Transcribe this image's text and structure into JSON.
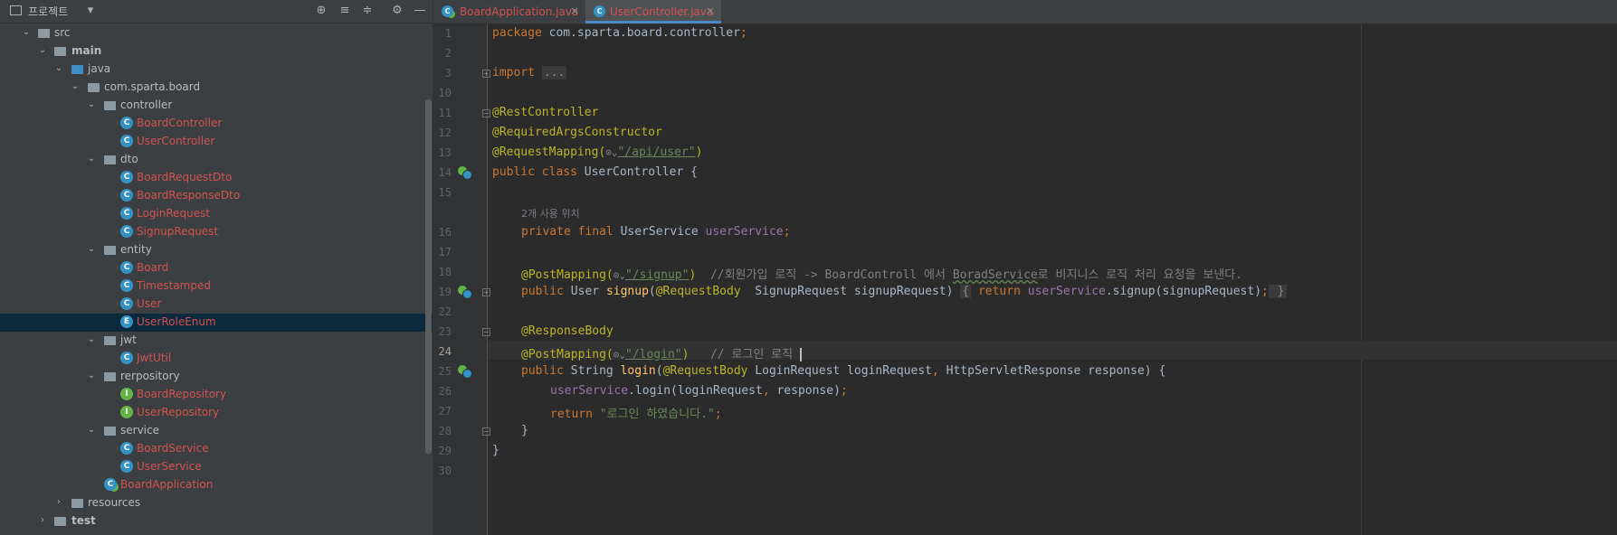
{
  "project_panel": {
    "title": "프로젝트",
    "dropdown_icon": "chevron-down-icon",
    "toolbar_icons": [
      "locate-icon",
      "expand-all-icon",
      "collapse-all-icon",
      "gear-icon",
      "minimize-icon"
    ]
  },
  "tree": {
    "items": [
      {
        "label": "src"
      },
      {
        "label": "main"
      },
      {
        "label": "java"
      },
      {
        "label": "com.sparta.board"
      },
      {
        "label": "controller"
      },
      {
        "label": "BoardController"
      },
      {
        "label": "UserController"
      },
      {
        "label": "dto"
      },
      {
        "label": "BoardRequestDto"
      },
      {
        "label": "BoardResponseDto"
      },
      {
        "label": "LoginRequest"
      },
      {
        "label": "SignupRequest"
      },
      {
        "label": "entity"
      },
      {
        "label": "Board"
      },
      {
        "label": "Timestamped"
      },
      {
        "label": "User"
      },
      {
        "label": "UserRoleEnum"
      },
      {
        "label": "jwt"
      },
      {
        "label": "JwtUtil"
      },
      {
        "label": "rerpository"
      },
      {
        "label": "BoardRepository"
      },
      {
        "label": "UserRepository"
      },
      {
        "label": "service"
      },
      {
        "label": "BoardService"
      },
      {
        "label": "UserService"
      },
      {
        "label": "BoardApplication"
      },
      {
        "label": "resources"
      },
      {
        "label": "test"
      }
    ],
    "icon_letters": {
      "class": "C",
      "interface": "I",
      "enum": "E"
    }
  },
  "tabs": [
    {
      "label": "BoardApplication.java",
      "close": "×"
    },
    {
      "label": "UserController.java",
      "close": "×"
    }
  ],
  "editor": {
    "line_numbers": [
      "1",
      "2",
      "3",
      "10",
      "11",
      "12",
      "13",
      "14",
      "15",
      "16",
      "17",
      "18",
      "19",
      "22",
      "23",
      "24",
      "25",
      "26",
      "27",
      "28",
      "29",
      "30"
    ],
    "current_line": "24",
    "code": {
      "l1_kw": "package",
      "l1_rest": " com.sparta.board.controller",
      "l1_semi": ";",
      "l3_kw": "import",
      "l3_fold": "...",
      "l11": "@RestController",
      "l12": "@RequiredArgsConstructor",
      "l13_ann": "@RequestMapping(",
      "l13_str": "\"/api/user\"",
      "l13_close": ")",
      "l14_kw": "public class ",
      "l14_rest": "UserController {",
      "hint": "2개 사용 위치",
      "l16_kw": "private final ",
      "l16_type": "UserService ",
      "l16_fld": "userService",
      "l16_semi": ";",
      "l18_ann": "@PostMapping(",
      "l18_str": "\"/signup\"",
      "l18_close": ")",
      "l18_cmt": "//회원가입 로직 -> BoardControll 에서 ",
      "l18_cmt_wavy": "BoradService",
      "l18_cmt_end": "로 비지니스 로직 처리 요청을 보낸다.",
      "l19_kw": "public ",
      "l19_type": "User ",
      "l19_fn": "signup",
      "l19_paren": "(",
      "l19_ann": "@RequestBody",
      "l19_params": "  SignupRequest signupRequest) ",
      "l19_fold_open": "{",
      "l19_ret": " return ",
      "l19_fld": "userService",
      "l19_call": ".signup(signupRequest)",
      "l19_semi": ";",
      "l19_fold_close": " }",
      "l23": "@ResponseBody",
      "l24_ann": "@PostMapping(",
      "l24_str": "\"/login\"",
      "l24_close": ")",
      "l24_cmt": "// 로그인 로직 ",
      "l25_kw": "public ",
      "l25_type": "String ",
      "l25_fn": "login",
      "l25_paren": "(",
      "l25_ann": "@RequestBody",
      "l25_p1": " LoginRequest loginRequest",
      "l25_comma": ", ",
      "l25_p2": "HttpServletResponse response) {",
      "l26_fld": "userService",
      "l26_call": ".login(loginRequest",
      "l26_comma": ", ",
      "l26_rest": "response)",
      "l26_semi": ";",
      "l27_kw": "return ",
      "l27_str": "\"로그인 하였습니다.\"",
      "l27_semi": ";",
      "l28": "}",
      "l29": "}",
      "chip": "⊙⌄"
    }
  },
  "colors": {
    "background": "#2b2b2b",
    "keyword": "#cc7832",
    "annotation": "#bbb529",
    "string": "#6a8759",
    "field": "#9876aa",
    "method": "#ffc66d",
    "modified_file": "#d25252",
    "selection": "#0d293e"
  }
}
